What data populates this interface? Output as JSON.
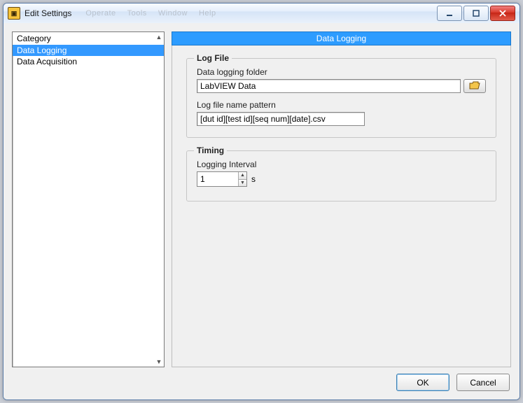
{
  "window": {
    "title": "Edit Settings",
    "menu_ghost": [
      "Operate",
      "Tools",
      "Window",
      "Help"
    ]
  },
  "sidebar": {
    "header": "Category",
    "items": [
      {
        "label": "Data Logging",
        "selected": true
      },
      {
        "label": "Data Acquisition",
        "selected": false
      }
    ]
  },
  "pane": {
    "header": "Data Logging",
    "logfile": {
      "legend": "Log File",
      "folder_label": "Data logging folder",
      "folder_value": "LabVIEW Data",
      "pattern_label": "Log file name pattern",
      "pattern_value": "[dut id][test id][seq num][date].csv"
    },
    "timing": {
      "legend": "Timing",
      "interval_label": "Logging Interval",
      "interval_value": "1",
      "interval_unit": "s"
    }
  },
  "buttons": {
    "ok": "OK",
    "cancel": "Cancel"
  }
}
